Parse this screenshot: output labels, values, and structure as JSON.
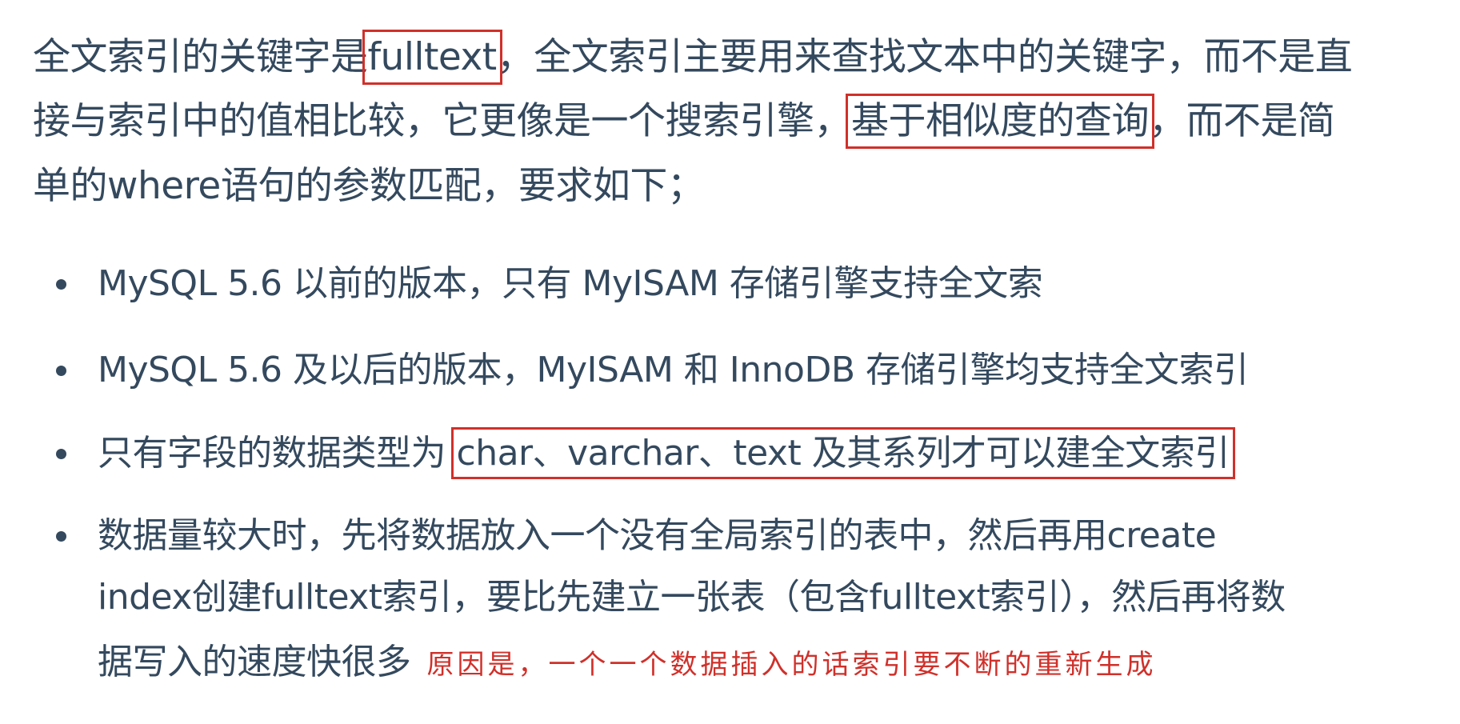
{
  "paragraph": {
    "line1_a": "全文索引的关键字是",
    "line1_box": "fulltext",
    "line1_b": "，全文索引主要用来查找文本中的关键字，而不是直",
    "line2_a": "接与索引中的值相比较，它更像是一个搜索引擎，",
    "line2_box": "基于相似度的查询",
    "line2_b": "，而不是简",
    "line3": "单的where语句的参数匹配，要求如下；"
  },
  "bullets": [
    {
      "text": "MySQL 5.6 以前的版本，只有 MyISAM 存储引擎支持全文索"
    },
    {
      "text": "MySQL 5.6 及以后的版本，MyISAM 和 InnoDB 存储引擎均支持全文索引"
    },
    {
      "text_a": "只有字段的数据类型为 ",
      "text_box": "char、varchar、text 及其系列才可以建全文索引"
    },
    {
      "line1": "数据量较大时，先将数据放入一个没有全局索引的表中，然后再用create",
      "line2": "index创建fulltext索引，要比先建立一张表（包含fulltext索引），然后再将数",
      "line3": "据写入的速度快很多",
      "note": "原因是，一个一个数据插入的话索引要不断的重新生成"
    }
  ],
  "colors": {
    "text": "#34495e",
    "highlight": "#d0302a"
  }
}
